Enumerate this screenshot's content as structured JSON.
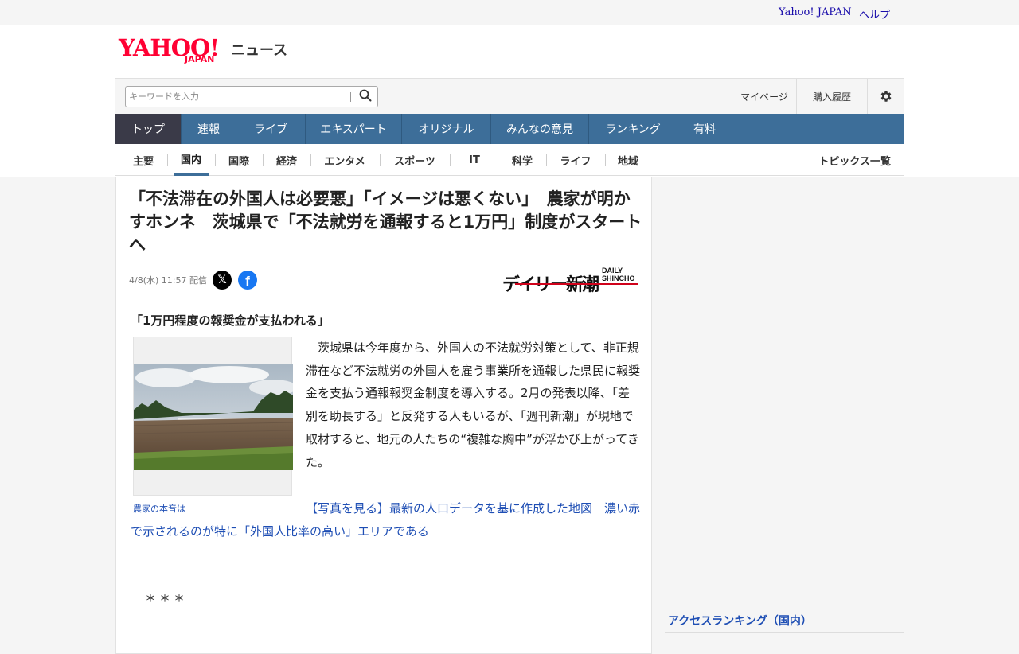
{
  "topbar": {
    "links": [
      "Yahoo! JAPAN",
      "ヘルプ"
    ]
  },
  "logo": {
    "yahoo": "YAHOO!",
    "japan": "JAPAN",
    "service": "ニュース"
  },
  "search": {
    "placeholder": "キーワードを入力"
  },
  "utility": {
    "mypage": "マイページ",
    "history": "購入履歴"
  },
  "global_nav": [
    {
      "label": "トップ",
      "active": true
    },
    {
      "label": "速報"
    },
    {
      "label": "ライブ"
    },
    {
      "label": "エキスパート"
    },
    {
      "label": "オリジナル"
    },
    {
      "label": "みんなの意見"
    },
    {
      "label": "ランキング"
    },
    {
      "label": "有料"
    }
  ],
  "sub_nav": [
    {
      "label": "主要"
    },
    {
      "label": "国内",
      "active": true
    },
    {
      "label": "国際"
    },
    {
      "label": "経済"
    },
    {
      "label": "エンタメ"
    },
    {
      "label": "スポーツ"
    },
    {
      "label": "IT"
    },
    {
      "label": "科学"
    },
    {
      "label": "ライフ"
    },
    {
      "label": "地域"
    }
  ],
  "topics_link": "トピックス一覧",
  "article": {
    "headline": "「不法滞在の外国人は必要悪」「イメージは悪くない」　農家が明かすホンネ　茨城県で「不法就労を通報すると1万円」制度がスタートへ",
    "date": "4/8(水) 11:57 配信",
    "publisher_main": "デイリー新潮",
    "publisher_en_1": "DAILY",
    "publisher_en_2": "SHINCHO",
    "subhead": "「1万円程度の報奨金が支払われる」",
    "photo_caption": "農家の本音は",
    "body": "茨城県は今年度から、外国人の不法就労対策として、非正規滞在など不法就労の外国人を雇う事業所を通報した県民に報奨金を支払う通報報奨金制度を導入する。2月の発表以降、「差別を助長する」と反発する人もいるが、「週刊新潮」が現地で取材すると、地元の人たちの“複雑な胸中”が浮かび上がってきた。",
    "photo_link": "【写真を見る】最新の人口データを基に作成した地図　濃い赤で示されるのが特に「外国人比率の高い」エリアである",
    "separator": "＊＊＊"
  },
  "ranking": {
    "title": "アクセスランキング（国内）"
  },
  "colors": {
    "nav_blue": "#3d6e99",
    "nav_active": "#3a3a48",
    "brand_red": "#ff0033",
    "link_blue": "#1e4eb4"
  }
}
